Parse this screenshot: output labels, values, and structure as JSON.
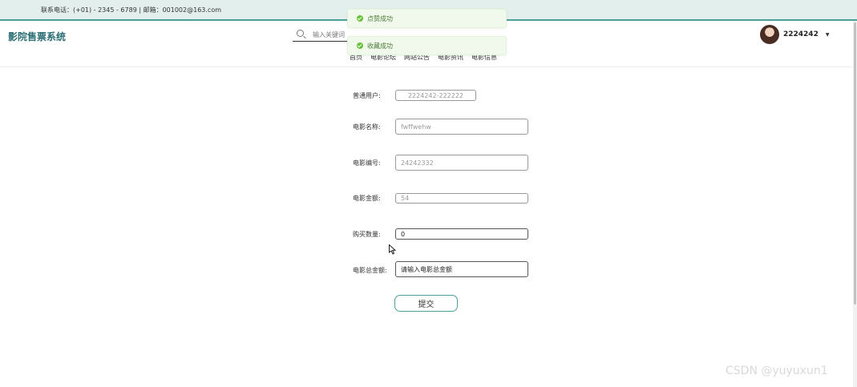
{
  "topbar": {
    "contact": "联系电话：(+01) - 2345 - 6789 | 邮箱：001002@163.com"
  },
  "header": {
    "brand": "影院售票系统",
    "search_placeholder": "输入关键词",
    "nav": [
      "首页",
      "电影论坛",
      "网站公告",
      "电影资讯",
      "电影信息"
    ],
    "username": "2224242",
    "caret": "▼"
  },
  "toasts": [
    "点赞成功",
    "收藏成功"
  ],
  "form": {
    "user_label": "普通用户:",
    "user_value": "2224242-222222",
    "movie_name_label": "电影名称:",
    "movie_name_value": "fwffwehw",
    "movie_no_label": "电影编号:",
    "movie_no_value": "24242332",
    "price_label": "电影金额:",
    "price_value": "54",
    "qty_label": "购买数量:",
    "qty_value": "0",
    "total_label": "电影总金额:",
    "total_placeholder": "请输入电影总金额",
    "submit_label": "提交"
  },
  "watermark": "CSDN @yuyuxun1",
  "colors": {
    "accent": "#4e9e98",
    "brand": "#2a6e74",
    "success": "#67c23a"
  }
}
